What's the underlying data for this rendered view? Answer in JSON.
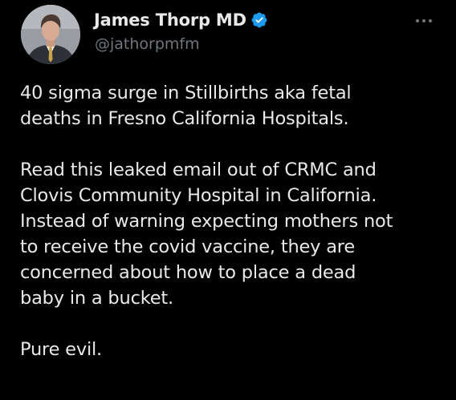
{
  "author": {
    "display_name": "James Thorp MD",
    "handle": "@jathorpmfm",
    "verified": true,
    "verified_color": "#1d9bf0"
  },
  "tweet": {
    "paragraphs": [
      {
        "lines": [
          "40 sigma surge in Stillbirths aka fetal",
          "deaths in Fresno California Hospitals."
        ]
      },
      {
        "lines": [
          "Read this leaked email out of CRMC and",
          "Clovis Community Hospital in California.",
          "Instead of warning expecting mothers not",
          "to receive the covid vaccine, they are",
          "concerned about how to place a dead",
          "baby in a bucket."
        ]
      },
      {
        "lines": [
          "Pure evil."
        ]
      }
    ]
  },
  "icons": {
    "verified": "verified-badge-icon",
    "more": "more-horizontal-icon",
    "avatar": "profile-photo"
  },
  "colors": {
    "background": "#000000",
    "text_primary": "#e7e9ea",
    "text_secondary": "#71767b"
  }
}
